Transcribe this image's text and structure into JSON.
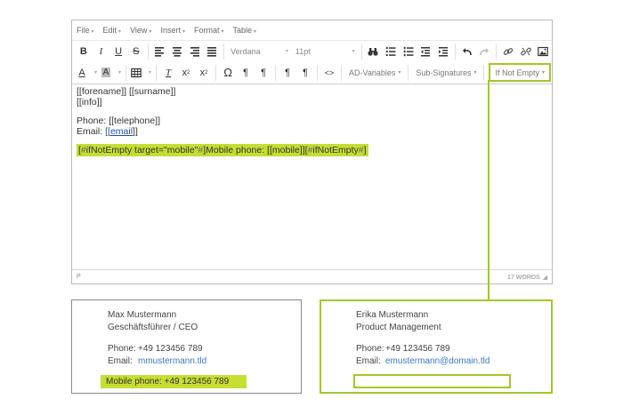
{
  "menubar": {
    "items": [
      "File",
      "Edit",
      "View",
      "Insert",
      "Format",
      "Table"
    ]
  },
  "toolbar": {
    "font_family": "Verdana",
    "font_size": "11pt",
    "ad_variables": "AD-Variables",
    "sub_signatures": "Sub-Signatures",
    "if_not_empty": "If Not Empty",
    "omega": "Ω",
    "code": "<>",
    "underline_a": "A",
    "highlight_a": "A",
    "bold": "B",
    "italic": "I",
    "underline": "U",
    "strike": "S",
    "clear_format": "T",
    "subscript": "x",
    "superscript": "x",
    "pilcrow": "¶"
  },
  "editor": {
    "line1": "[[forename]] [[surname]]",
    "line2": "[[info]]",
    "phone_label": "Phone: ",
    "phone_value": "[[telephone]]",
    "email_label": "Email: ",
    "email_open": "[[",
    "email_link": "email",
    "email_close": "]]",
    "cond_open_a": "[",
    "cond_open_b": "#",
    "cond_open_c": "ifNotEmpty target=\"mobile\"",
    "cond_open_d": "#",
    "cond_mid": "]Mobile phone: [[mobile]][",
    "cond_close_b": "#",
    "cond_close_c": "ifNotEmpty",
    "cond_close_d": "#",
    "cond_close_e": "]"
  },
  "statusbar": {
    "path": "P",
    "word_count": "17 WORDS"
  },
  "preview_left": {
    "name": "Max Mustermann",
    "title": "Geschäftsführer / CEO",
    "phone_label": "Phone:",
    "phone_value": "+49 123456 789",
    "email_label": "Email:",
    "email_value": "mmustermann.tld",
    "mobile": "Mobile phone:  +49  123456 789"
  },
  "preview_right": {
    "name": "Erika Mustermann",
    "title": "Product Management",
    "phone_label": "Phone:",
    "phone_value": "+49 123456 789",
    "email_label": "Email:",
    "email_value": "emustermann@domain.tld"
  },
  "colors": {
    "accent_green": "#a3c72a",
    "highlight_green": "#c6dd32",
    "link_blue": "#3a78c2"
  }
}
